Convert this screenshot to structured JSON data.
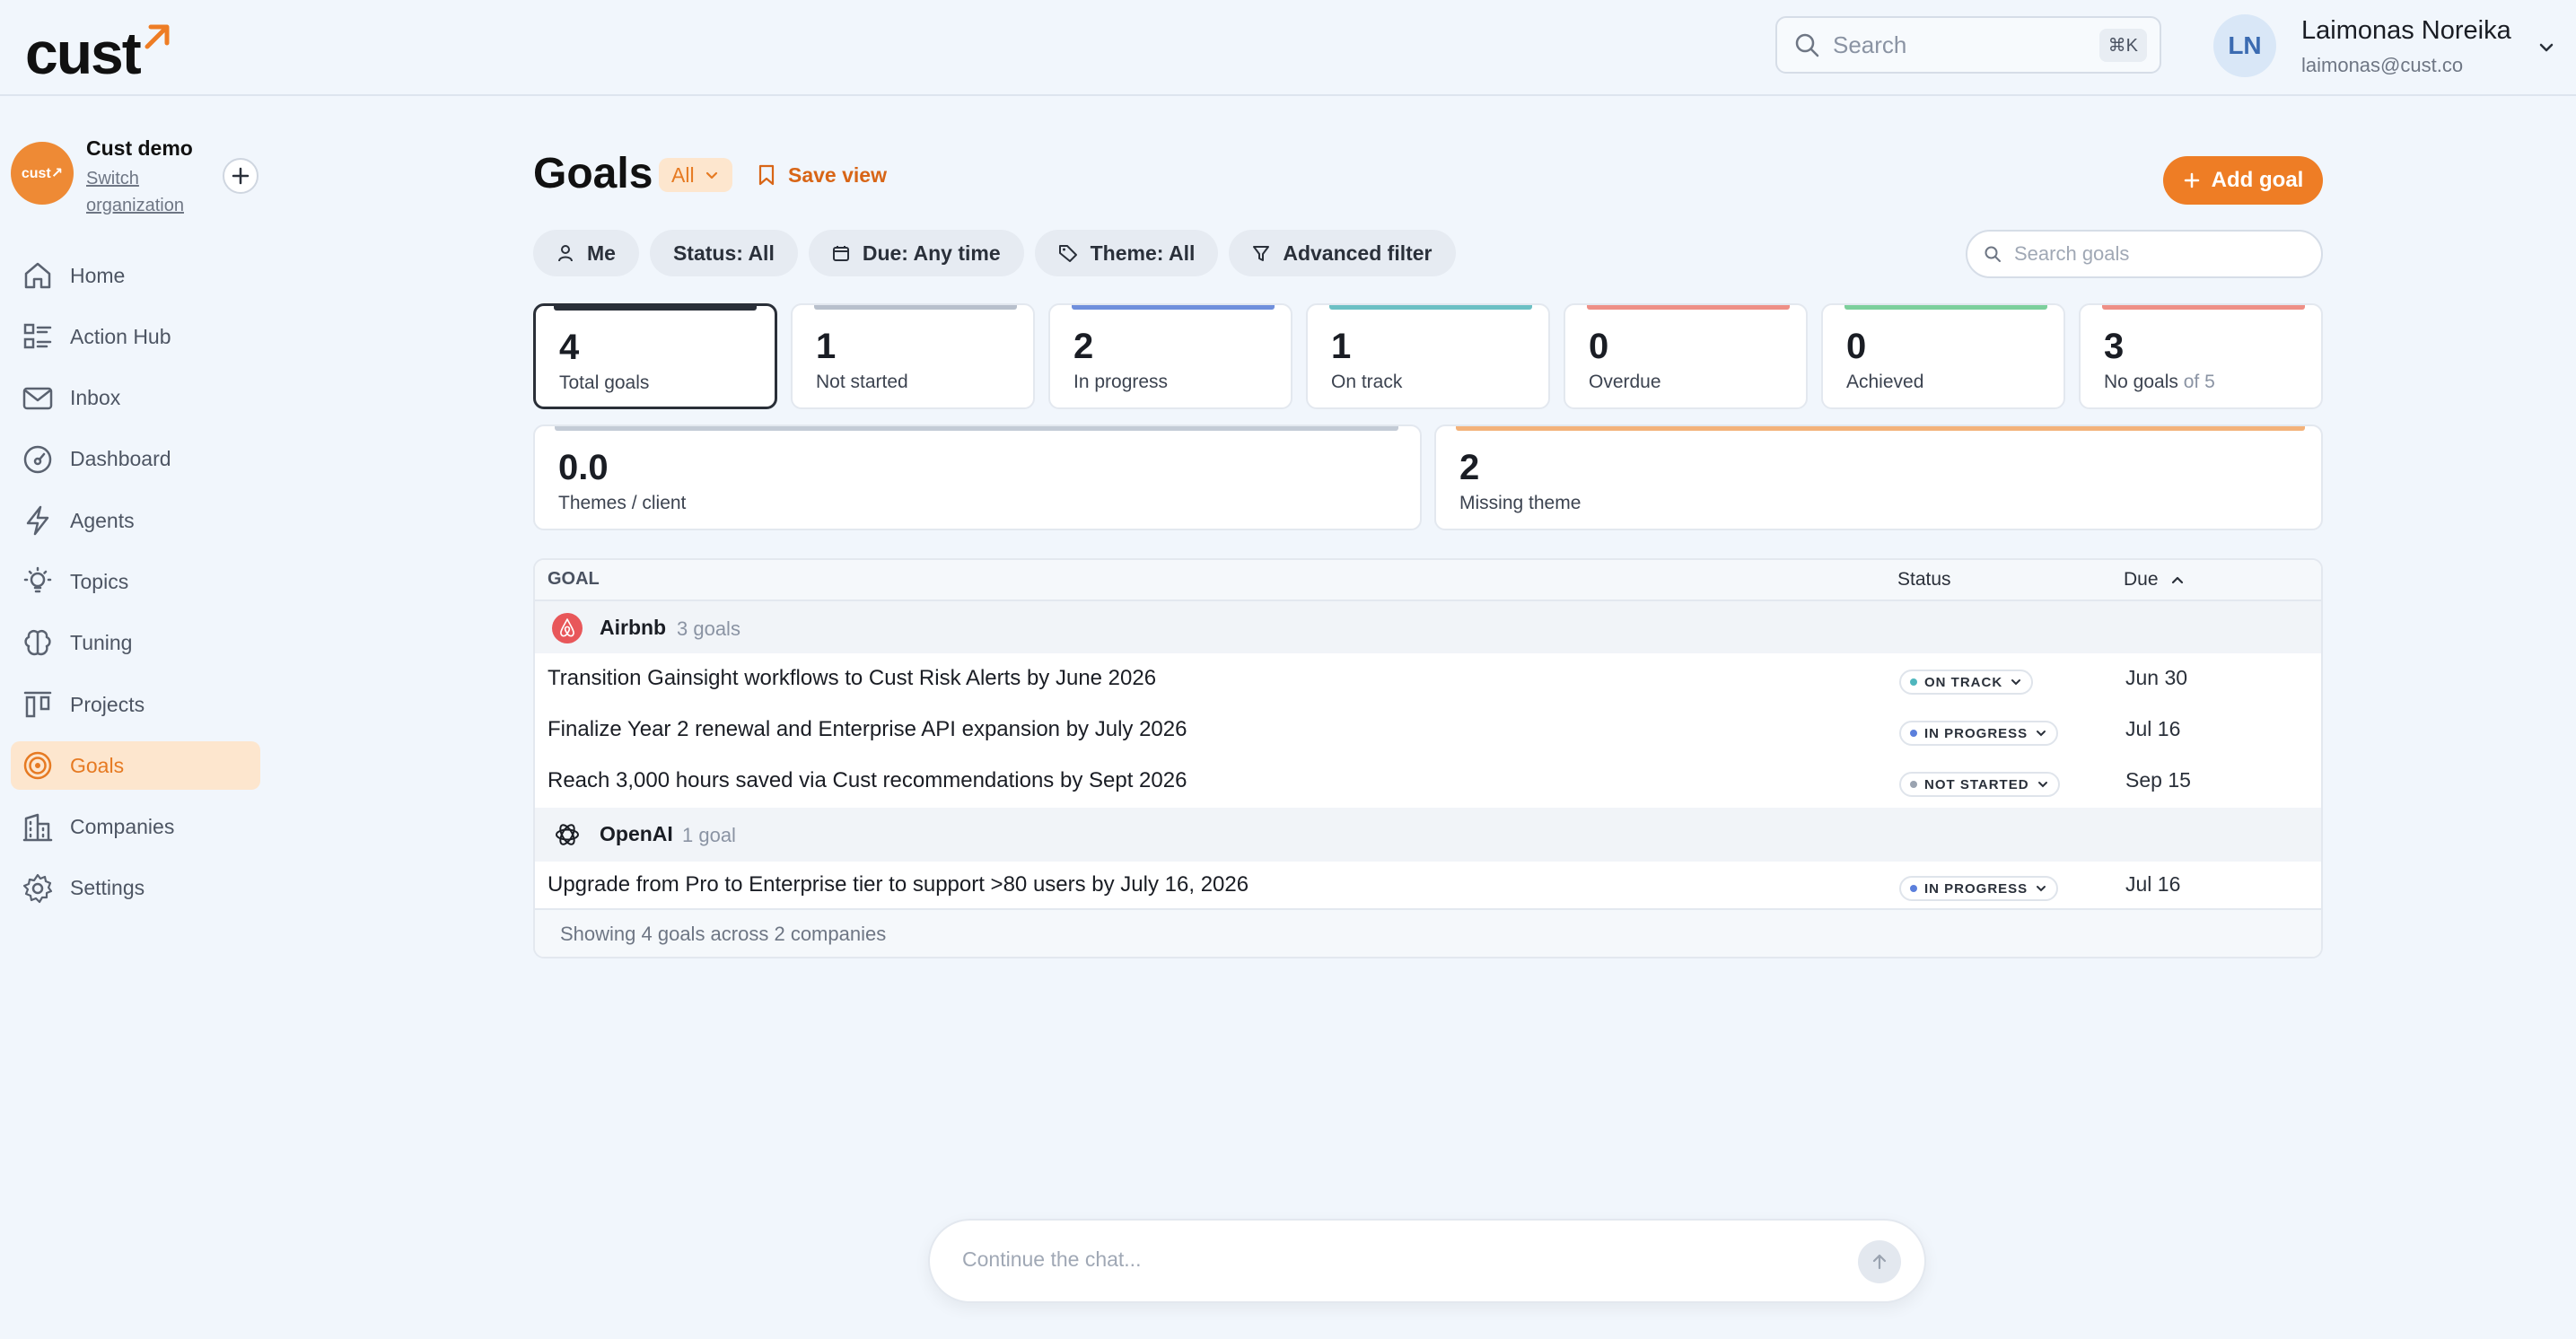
{
  "app": {
    "logo_text": "cust"
  },
  "header": {
    "search_placeholder": "Search",
    "search_shortcut": "⌘K",
    "user_initials": "LN",
    "user_name": "Laimonas Noreika",
    "user_email": "laimonas@cust.co"
  },
  "org": {
    "logo_text": "cust↗",
    "name": "Cust demo",
    "switch_label": "Switch organization"
  },
  "sidebar": {
    "items": [
      {
        "label": "Home",
        "icon": "home-icon"
      },
      {
        "label": "Action Hub",
        "icon": "list-icon"
      },
      {
        "label": "Inbox",
        "icon": "mail-icon"
      },
      {
        "label": "Dashboard",
        "icon": "gauge-icon"
      },
      {
        "label": "Agents",
        "icon": "lightning-icon"
      },
      {
        "label": "Topics",
        "icon": "lightbulb-icon"
      },
      {
        "label": "Tuning",
        "icon": "brain-icon"
      },
      {
        "label": "Projects",
        "icon": "kanban-icon"
      },
      {
        "label": "Goals",
        "icon": "target-icon",
        "active": true
      },
      {
        "label": "Companies",
        "icon": "building-icon"
      },
      {
        "label": "Settings",
        "icon": "gear-icon"
      }
    ]
  },
  "page": {
    "title": "Goals",
    "view_select": "All",
    "save_view": "Save view",
    "add_goal": "Add goal",
    "goal_search_placeholder": "Search goals"
  },
  "filters": {
    "me": "Me",
    "status": "Status: All",
    "due": "Due: Any time",
    "theme": "Theme: All",
    "advanced": "Advanced filter"
  },
  "stats": [
    {
      "value": "4",
      "label": "Total goals",
      "color": "#2a2f38"
    },
    {
      "value": "1",
      "label": "Not started",
      "color": "#b8c0cc"
    },
    {
      "value": "2",
      "label": "In progress",
      "color": "#6f8fdc"
    },
    {
      "value": "1",
      "label": "On track",
      "color": "#6cc0c4"
    },
    {
      "value": "0",
      "label": "Overdue",
      "color": "#ee8f86"
    },
    {
      "value": "0",
      "label": "Achieved",
      "color": "#7ccf9c"
    },
    {
      "value": "3",
      "label": "No goals",
      "suffix": "of 5",
      "color": "#ee8f86"
    }
  ],
  "stats2": [
    {
      "value": "0.0",
      "label": "Themes / client",
      "color": "#c3cbd6"
    },
    {
      "value": "2",
      "label": "Missing theme",
      "color": "#f3b27a"
    }
  ],
  "table": {
    "col_goal": "GOAL",
    "col_status": "Status",
    "col_due": "Due",
    "groups": [
      {
        "company": "Airbnb",
        "count": "3 goals",
        "goals": [
          {
            "title": "Transition Gainsight workflows to Cust Risk Alerts by June 2026",
            "status": "ON TRACK",
            "status_color": "#4fb6bd",
            "due": "Jun 30"
          },
          {
            "title": "Finalize Year 2 renewal and Enterprise API expansion by July 2026",
            "status": "IN PROGRESS",
            "status_color": "#5b7fdc",
            "due": "Jul 16"
          },
          {
            "title": "Reach 3,000 hours saved via Cust recommendations by Sept 2026",
            "status": "NOT STARTED",
            "status_color": "#9aa3b0",
            "due": "Sep 15"
          }
        ]
      },
      {
        "company": "OpenAI",
        "count": "1 goal",
        "goals": [
          {
            "title": "Upgrade from Pro to Enterprise tier to support >80 users by July 16, 2026",
            "status": "IN PROGRESS",
            "status_color": "#5b7fdc",
            "due": "Jul 16"
          }
        ]
      }
    ],
    "footer": "Showing 4 goals across 2 companies"
  },
  "chat": {
    "placeholder": "Continue the chat..."
  },
  "colors": {
    "accent": "#ee7d25",
    "accent_light": "#fde6ce",
    "background": "#f1f6fc"
  }
}
